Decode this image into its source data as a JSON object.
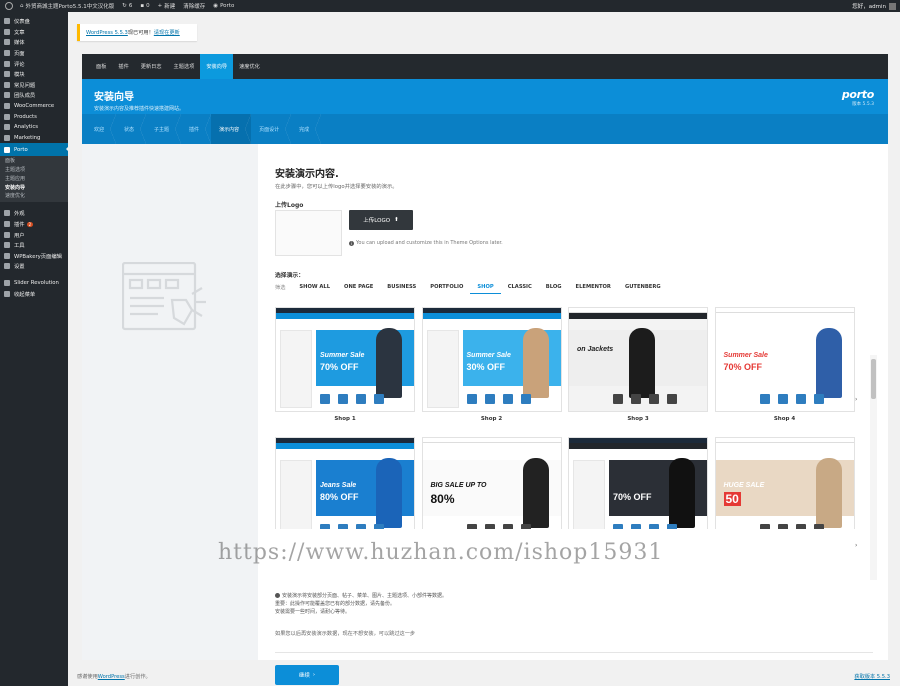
{
  "adminbar": {
    "site_name": "外贸商城主题Porto5.5.1中文汉化版",
    "updates": "6",
    "comments": "0",
    "new": "新建",
    "clear_cache": "清除缓存",
    "porto": "Porto",
    "greeting": "您好，admin"
  },
  "sidebar": {
    "items": [
      {
        "label": "仪表盘",
        "icon": "dashboard-icon"
      },
      {
        "label": "文章",
        "icon": "pin-icon"
      },
      {
        "label": "媒体",
        "icon": "media-icon"
      },
      {
        "label": "页面",
        "icon": "page-icon"
      },
      {
        "label": "评论",
        "icon": "comment-icon"
      },
      {
        "label": "模块",
        "icon": "block-icon"
      },
      {
        "label": "常见问题",
        "icon": "faq-icon"
      },
      {
        "label": "团队成员",
        "icon": "team-icon"
      },
      {
        "label": "WooCommerce",
        "icon": "woo-icon"
      },
      {
        "label": "Products",
        "icon": "box-icon"
      },
      {
        "label": "Analytics",
        "icon": "chart-icon"
      },
      {
        "label": "Marketing",
        "icon": "megaphone-icon"
      }
    ],
    "active": {
      "label": "Porto",
      "icon": "porto-icon"
    },
    "submenu": [
      "面板",
      "主题选项",
      "主题应用",
      "安装向导",
      "速度优化"
    ],
    "submenu_current": 3,
    "items2": [
      {
        "label": "外观",
        "icon": "brush-icon"
      },
      {
        "label": "插件",
        "icon": "plugin-icon",
        "badge": "2"
      },
      {
        "label": "用户",
        "icon": "user-icon"
      },
      {
        "label": "工具",
        "icon": "tools-icon"
      },
      {
        "label": "WPBakery页面编辑",
        "icon": "builder-icon"
      },
      {
        "label": "设置",
        "icon": "settings-icon"
      }
    ],
    "items3": [
      {
        "label": "Slider Revolution",
        "icon": "slider-icon"
      },
      {
        "label": "收起菜单",
        "icon": "collapse-icon"
      }
    ]
  },
  "notice": {
    "link": "WordPress 5.5.3",
    "text": "现已可用！",
    "action": "请现在更新"
  },
  "wizard": {
    "tabs": [
      "面板",
      "插件",
      "更新日志",
      "主题选项",
      "安装向导",
      "速度优化"
    ],
    "active_tab": 4,
    "title": "安装向导",
    "subtitle": "安装演示内容及推荐插件快速搭建网站。",
    "logo": "porto",
    "logo_version": "版本 5.5.3",
    "steps": [
      "欢迎",
      "状态",
      "子主题",
      "插件",
      "演示内容",
      "页面设计",
      "完成"
    ],
    "current_step": 4
  },
  "content": {
    "title": "安装演示内容.",
    "description": "在此步骤中，您可以上传logo并选择要安装的演示。",
    "logo_label": "上传Logo",
    "upload_button": "上传LOGO",
    "upload_help": "You can upload and customize this in Theme Options later.",
    "demo_label": "选择演示：",
    "filters": [
      "筛选",
      "SHOW ALL",
      "ONE PAGE",
      "BUSINESS",
      "PORTFOLIO",
      "SHOP",
      "CLASSIC",
      "BLOG",
      "ELEMENTOR",
      "GUTENBERG"
    ],
    "active_filter": 5,
    "demos": [
      {
        "name": "Shop 1",
        "banner": "Summer Sale",
        "percent": "70% OFF"
      },
      {
        "name": "Shop 2",
        "banner": "Summer Sale",
        "percent": "30% OFF"
      },
      {
        "name": "Shop 3",
        "banner": "on Jackets",
        "percent": ""
      },
      {
        "name": "Shop 4",
        "banner": "Summer Sale",
        "percent": "70% OFF"
      },
      {
        "name": "",
        "banner": "Jeans Sale",
        "percent": "80% OFF"
      },
      {
        "name": "",
        "banner": "BIG SALE UP TO",
        "percent": "80%"
      },
      {
        "name": "",
        "banner": "",
        "percent": "70% OFF"
      },
      {
        "name": "",
        "banner": "HUGE SALE",
        "percent": "50"
      }
    ],
    "note_lines": [
      "安装演示将安装部分页面、帖子、菜单、图片、主题选项、小部件等数据。",
      "重要：此操作可能覆盖您已有的部分数据，请先备份。",
      "安装需要一些时间，请耐心等待。"
    ],
    "skip_text": "如果您以后再安装演示数据，现在不想安装，可以跳过这一步",
    "next_button": "继续"
  },
  "footer": {
    "text": "感谢使用",
    "link": "WordPress",
    "text2": "进行创作。",
    "version": "获取版本 5.5.3"
  },
  "watermark": "https://www.huzhan.com/ishop15931",
  "colors": {
    "accent": "#0c8ed8",
    "admin_dark": "#23282d",
    "wp_blue": "#0073aa"
  }
}
